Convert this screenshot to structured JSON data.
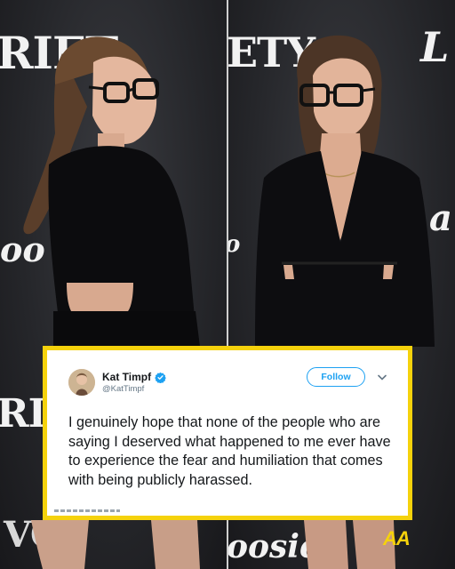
{
  "backdrop": {
    "left_top_logo": "RIET",
    "right_top_logo": "ETY",
    "left_mid_script": "oo",
    "left_bottom_logo": "RIT",
    "left_corner_mark": "VQ",
    "right_bottom_script": "oosie",
    "right_mid_script": "a"
  },
  "tweet": {
    "display_name": "Kat Timpf",
    "handle": "@KatTimpf",
    "follow_label": "Follow",
    "text": "I genuinely hope that none of the people who are saying I deserved what happened to me ever have to experience the fear and humiliation that comes with being publicly harassed.",
    "verified_color": "#1da1f2"
  },
  "watermark": {
    "text": "AA"
  },
  "colors": {
    "frame": "#f5d20c",
    "accent": "#1da1f2"
  }
}
